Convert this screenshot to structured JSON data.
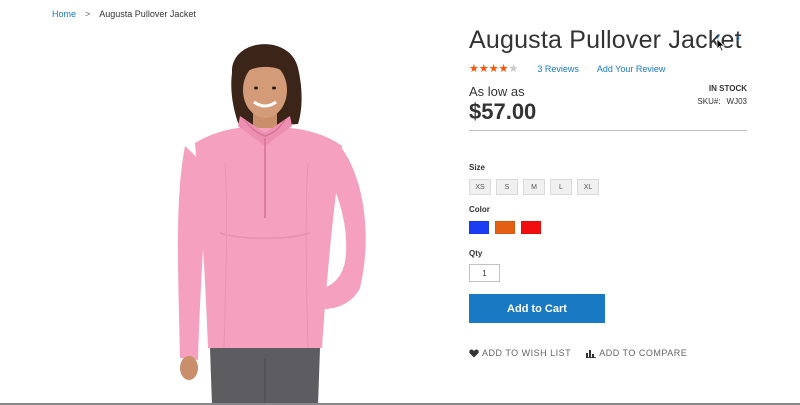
{
  "breadcrumb": {
    "home": "Home",
    "separator": ">",
    "current": "Augusta Pullover Jacket"
  },
  "product": {
    "title": "Augusta Pullover Jacket",
    "rating_fraction": 0.8,
    "reviews_label": "3  Reviews",
    "add_review_label": "Add Your Review",
    "price_prefix": "As low as",
    "price": "$57.00",
    "stock": "IN STOCK",
    "sku_label": "SKU#:",
    "sku": "WJ03",
    "image_icon": "product-photo-woman-pink-jacket"
  },
  "nav": {
    "prev_icon": "chevron-left-icon",
    "next_icon": "chevron-right-icon",
    "prev_glyph": "‹",
    "next_glyph": "›"
  },
  "options": {
    "size_label": "Size",
    "sizes": [
      "XS",
      "S",
      "M",
      "L",
      "XL"
    ],
    "color_label": "Color",
    "colors": [
      {
        "name": "blue",
        "hex": "#1a3cf2"
      },
      {
        "name": "orange",
        "hex": "#e25f14"
      },
      {
        "name": "red",
        "hex": "#f00e0e"
      }
    ],
    "qty_label": "Qty",
    "qty_value": "1"
  },
  "actions": {
    "add_to_cart": "Add to Cart",
    "wishlist": "ADD TO WISH LIST",
    "compare": "ADD TO COMPARE",
    "wishlist_icon": "heart-icon",
    "compare_icon": "bar-chart-icon"
  },
  "colors": {
    "accent": "#1979c3",
    "star": "#ff5501",
    "jacket_pink": "#f4a0be"
  }
}
